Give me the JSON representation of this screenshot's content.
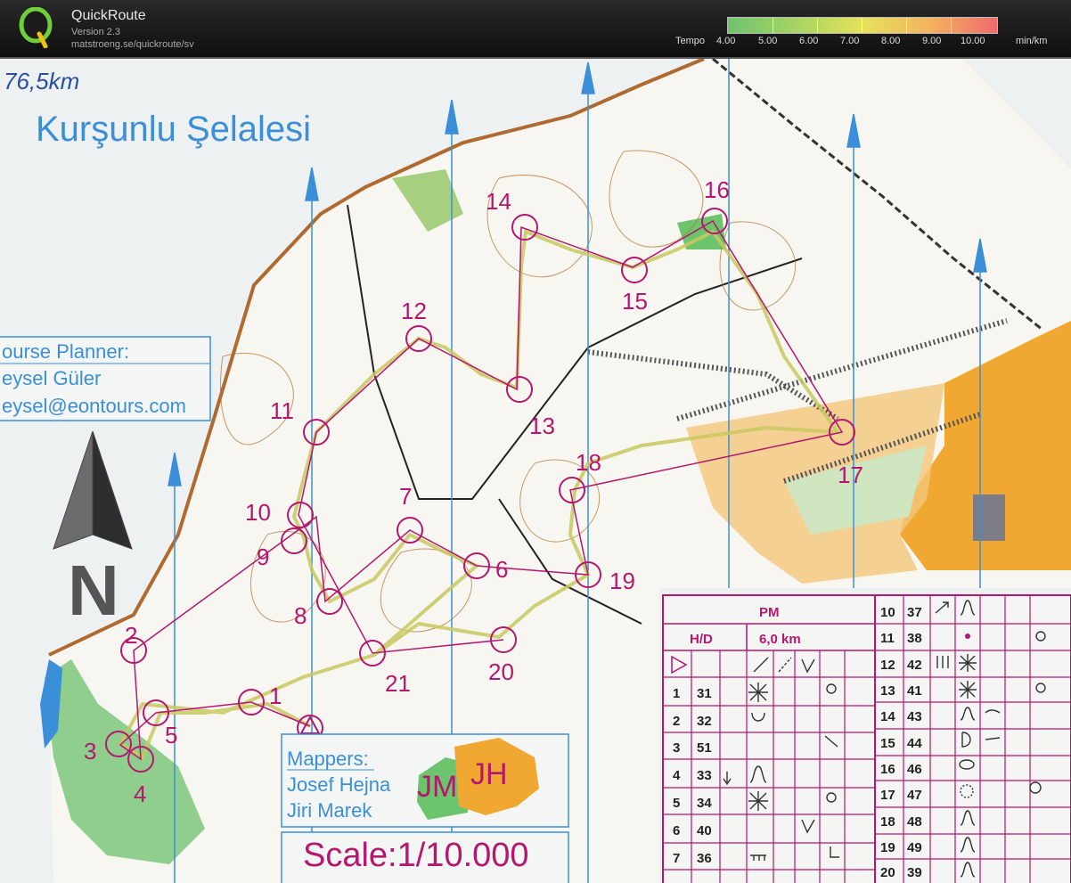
{
  "app": {
    "name": "QuickRoute",
    "version": "Version 2.3",
    "url": "matstroeng.se/quickroute/sv",
    "logo_letter": "Q"
  },
  "tempo": {
    "label": "Tempo",
    "ticks": [
      "4.00",
      "5.00",
      "6.00",
      "7.00",
      "8.00",
      "9.00",
      "10.00"
    ],
    "unit": "min/km",
    "colors": [
      "#6fc46f",
      "#a6d463",
      "#e6e25a",
      "#f4b360",
      "#f06a6a"
    ]
  },
  "map": {
    "handwritten_note": "76,5km",
    "title": "Kurşunlu Şelalesi",
    "planner": {
      "heading": "ourse Planner:",
      "name": "eysel Güler",
      "email": "eysel@eontours.com"
    },
    "north_letter": "N",
    "mappers": {
      "heading": "Mappers:",
      "names": [
        "Josef Hejna",
        "Jiri Marek"
      ],
      "logo_left": "JM",
      "logo_right": "JH"
    },
    "scale": "Scale:1/10.000",
    "controls": [
      "1",
      "2",
      "3",
      "4",
      "5",
      "6",
      "7",
      "8",
      "9",
      "10",
      "11",
      "12",
      "13",
      "14",
      "15",
      "16",
      "17",
      "18",
      "19",
      "20",
      "21"
    ]
  },
  "description_sheet": {
    "class": "PM",
    "category": "H/D",
    "length": "6,0 km",
    "left_rows": [
      {
        "n": "1",
        "code": "31"
      },
      {
        "n": "2",
        "code": "32"
      },
      {
        "n": "3",
        "code": "51"
      },
      {
        "n": "4",
        "code": "33"
      },
      {
        "n": "5",
        "code": "34"
      },
      {
        "n": "6",
        "code": "40"
      },
      {
        "n": "7",
        "code": "36"
      }
    ],
    "right_rows": [
      {
        "n": "10",
        "code": "37"
      },
      {
        "n": "11",
        "code": "38"
      },
      {
        "n": "12",
        "code": "42"
      },
      {
        "n": "13",
        "code": "41"
      },
      {
        "n": "14",
        "code": "43"
      },
      {
        "n": "15",
        "code": "44"
      },
      {
        "n": "16",
        "code": "46"
      },
      {
        "n": "17",
        "code": "47"
      },
      {
        "n": "18",
        "code": "48"
      },
      {
        "n": "19",
        "code": "49"
      },
      {
        "n": "20",
        "code": "39"
      }
    ]
  },
  "colors": {
    "route_magenta": "#b5176f",
    "open_land": "#f0a832",
    "water": "#3a8fd8",
    "forest_green": "#6cc46c"
  }
}
